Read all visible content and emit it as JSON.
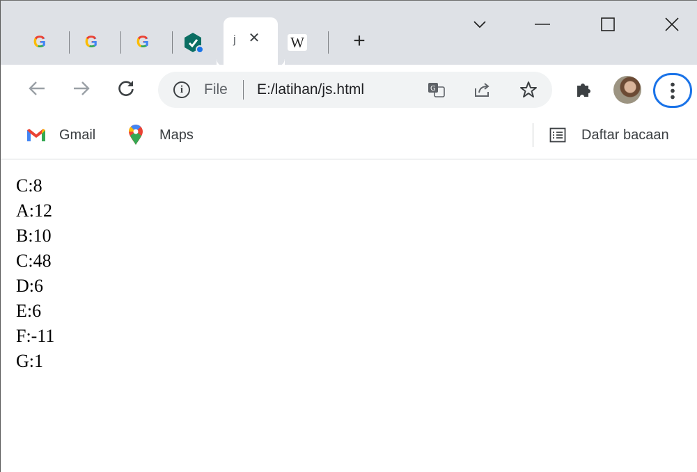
{
  "tabs": [
    {
      "favicon": "google-g-icon",
      "title": ""
    },
    {
      "favicon": "google-g-icon",
      "title": ""
    },
    {
      "favicon": "google-g-icon",
      "title": ""
    },
    {
      "favicon": "teal-app-icon",
      "title": ""
    },
    {
      "favicon": "file-icon",
      "title": "j",
      "active": true
    },
    {
      "favicon": "wikipedia-w-icon",
      "title": ""
    }
  ],
  "google_letter": "G",
  "wiki_letter": "W",
  "window_controls": {
    "tab_search": "⌄",
    "minimize": "—",
    "maximize": "☐",
    "close": "✕"
  },
  "toolbar": {
    "scheme_label": "File",
    "url": "E:/latihan/js.html",
    "icons": [
      "back-arrow-icon",
      "forward-arrow-icon",
      "reload-icon",
      "info-icon",
      "translate-icon",
      "share-icon",
      "bookmark-star-icon",
      "extensions-puzzle-icon",
      "profile-avatar",
      "menu-kebab-icon"
    ]
  },
  "bookmarks": {
    "items": [
      {
        "label": "Gmail",
        "icon": "gmail-icon"
      },
      {
        "label": "Maps",
        "icon": "maps-pin-icon"
      }
    ],
    "reading_list": "Daftar bacaan"
  },
  "content": {
    "lines": [
      "C:8",
      "A:12",
      "B:10",
      "C:48",
      "D:6",
      "E:6",
      "F:-11",
      "G:1"
    ]
  },
  "colors": {
    "accent": "#1a73e8",
    "tabstrip": "#dee1e6",
    "omnibox": "#f1f3f4"
  }
}
